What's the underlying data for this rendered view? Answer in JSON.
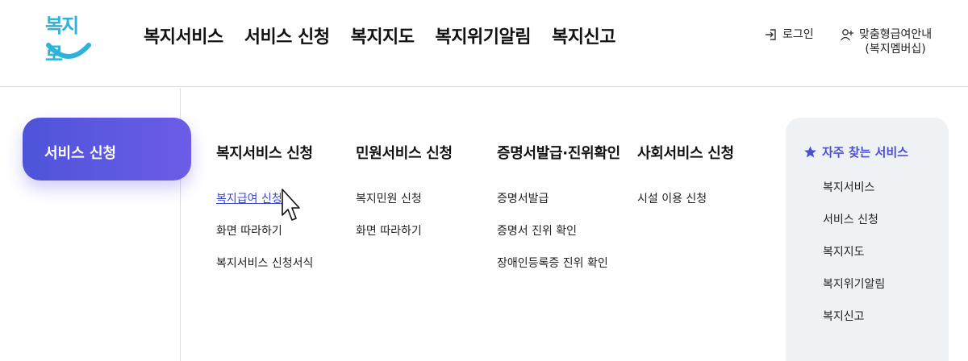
{
  "logo": {
    "text": "복지로"
  },
  "gnb": [
    {
      "label": "복지서비스"
    },
    {
      "label": "서비스 신청"
    },
    {
      "label": "복지지도"
    },
    {
      "label": "복지위기알림"
    },
    {
      "label": "복지신고"
    }
  ],
  "util": {
    "login": "로그인",
    "member_line1": "맞춤형급여안내",
    "member_line2": "(복지멤버십)"
  },
  "side": {
    "active_label": "서비스 신청"
  },
  "menu": [
    {
      "title": "복지서비스 신청",
      "items": [
        "복지급여 신청",
        "화면 따라하기",
        "복지서비스 신청서식"
      ]
    },
    {
      "title": "민원서비스 신청",
      "items": [
        "복지민원 신청",
        "화면 따라하기"
      ]
    },
    {
      "title": "증명서발급·진위확인",
      "items": [
        "증명서발급",
        "증명서 진위 확인",
        "장애인등록증 진위 확인"
      ]
    },
    {
      "title": "사회서비스 신청",
      "items": [
        "시설 이용 신청"
      ]
    }
  ],
  "favorites": {
    "title": "자주 찾는 서비스",
    "items": [
      "복지서비스",
      "서비스 신청",
      "복지지도",
      "복지위기알림",
      "복지신고"
    ]
  },
  "colors": {
    "accent": "#4b4fd6",
    "logo": "#2bb3d9",
    "pill_start": "#4e54d9",
    "pill_end": "#6c5ce7"
  }
}
